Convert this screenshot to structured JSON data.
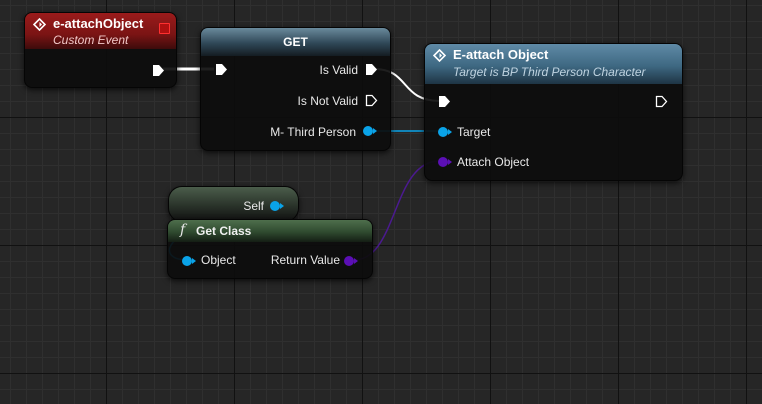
{
  "colors": {
    "exec_pin": "#ffffff",
    "object_pin": "#0aa3e8",
    "class_pin": "#5b0fb5",
    "event_header": "#8c1818",
    "function_header": "#4d7896",
    "pure_function_header": "#3b5a3a",
    "wire_exec": "#ffffff",
    "wire_object": "#0aa3e8",
    "wire_class": "#4b1a90"
  },
  "event_node": {
    "icon": "event-diamond-icon",
    "title": "e-attachObject",
    "subtitle": "Custom Event",
    "delegate_icon": "delegate-pin-icon"
  },
  "get_node": {
    "title": "GET",
    "is_valid": "Is Valid",
    "is_not_valid": "Is Not Valid",
    "variable": "M- Third Person"
  },
  "function_node": {
    "icon": "function-diamond-icon",
    "title": "E-attach Object",
    "subtitle": "Target is BP Third Person Character",
    "target": "Target",
    "attach_object": "Attach Object"
  },
  "self_node": {
    "label": "Self"
  },
  "get_class_node": {
    "icon": "function-f-icon",
    "title": "Get Class",
    "object": "Object",
    "return_value": "Return Value"
  }
}
